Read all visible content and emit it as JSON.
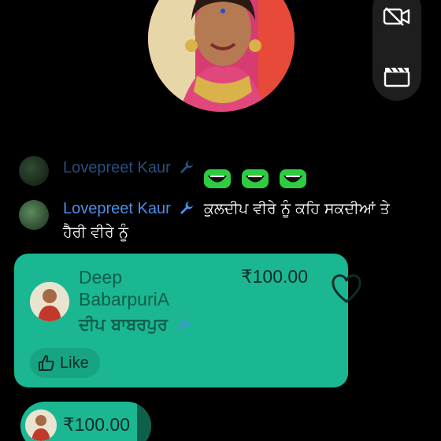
{
  "host": {
    "avatar_icon": "host-avatar-photo"
  },
  "controls": {
    "camera_icon": "camera-off-icon",
    "film_icon": "clapperboard-icon"
  },
  "chat": {
    "faded_message": {
      "user": "Lovepreet Kaur",
      "emoji_count": 3
    },
    "main_message": {
      "user": "Lovepreet Kaur",
      "text": "ਕੁਲਦੀਪ ਵੀਰੇ ਨੂੰ ਕਹਿ ਸਕਦੀਆਂ ਤੇ ਹੈਰੀ ਵੀਰੇ ਨੂੰ"
    }
  },
  "gift": {
    "name_line1": "Deep",
    "name_line2": "BabarpuriA",
    "punjabi_name": "ਦੀਪ ਬਾਬਰਪੁਰ",
    "amount": "₹100.00",
    "like_label": "Like"
  },
  "bottom_pill": {
    "amount": "₹100.00"
  },
  "colors": {
    "card": "#1ab792",
    "username": "#4a90e8",
    "background": "#000000"
  }
}
